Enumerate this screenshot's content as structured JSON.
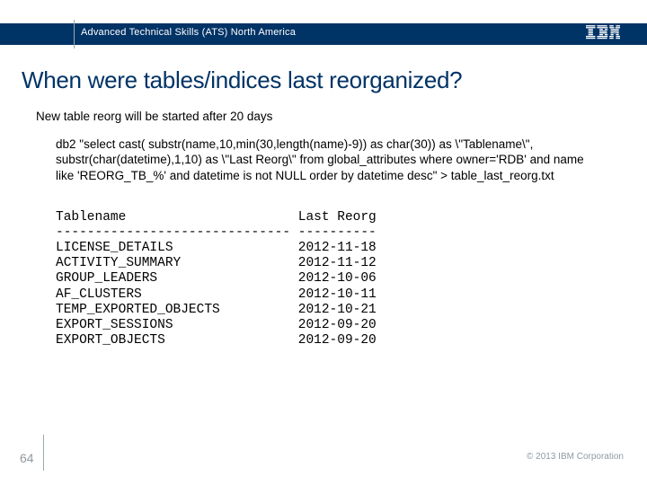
{
  "header": {
    "org": "Advanced Technical Skills (ATS) North America",
    "logo": "IBM"
  },
  "title": "When were tables/indices last reorganized?",
  "subtitle": "New table reorg will be started after 20 days",
  "sql": "db2 \"select cast( substr(name,10,min(30,length(name)-9)) as char(30)) as \\\"Tablename\\\", substr(char(datetime),1,10) as \\\"Last Reorg\\\" from global_attributes where owner='RDB' and name like 'REORG_TB_%' and datetime is not NULL order by datetime desc\" > table_last_reorg.txt",
  "table": {
    "col1_header": "Tablename",
    "col2_header": "Last Reorg",
    "col1_rule": "------------------------------",
    "col2_rule": "----------",
    "rows": [
      {
        "name": "LICENSE_DETAILS",
        "date": "2012-11-18"
      },
      {
        "name": "ACTIVITY_SUMMARY",
        "date": "2012-11-12"
      },
      {
        "name": "GROUP_LEADERS",
        "date": "2012-10-06"
      },
      {
        "name": "AF_CLUSTERS",
        "date": "2012-10-11"
      },
      {
        "name": "TEMP_EXPORTED_OBJECTS",
        "date": "2012-10-21"
      },
      {
        "name": "EXPORT_SESSIONS",
        "date": "2012-09-20"
      },
      {
        "name": "EXPORT_OBJECTS",
        "date": "2012-09-20"
      }
    ]
  },
  "footer": {
    "page": "64",
    "copyright": "© 2013 IBM Corporation"
  }
}
